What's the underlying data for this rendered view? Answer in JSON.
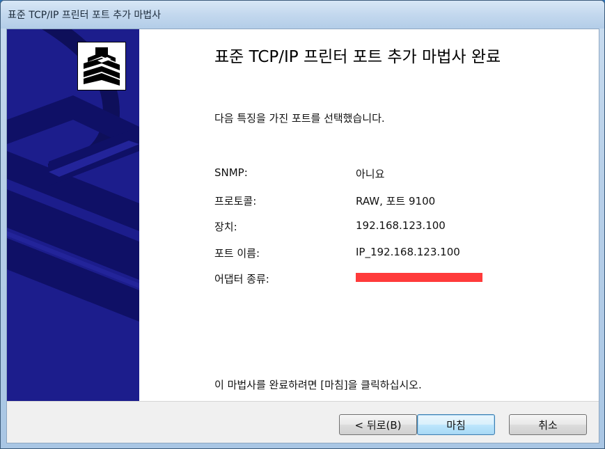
{
  "window": {
    "title": "표준 TCP/IP 프린터 포트 추가 마법사"
  },
  "main": {
    "heading": "표준 TCP/IP 프린터 포트 추가 마법사 완료",
    "intro": "다음 특징을 가진 포트를 선택했습니다.",
    "rows": [
      {
        "label": "SNMP:",
        "value": "아니요"
      },
      {
        "label": "프로토콜:",
        "value": "RAW, 포트 9100"
      },
      {
        "label": "장치:",
        "value": "192.168.123.100"
      },
      {
        "label": "포트 이름:",
        "value": "IP_192.168.123.100"
      },
      {
        "label": "어댑터 종류:",
        "value": ""
      }
    ],
    "footer": "이 마법사를 완료하려면 [마침]을 클릭하십시오."
  },
  "buttons": {
    "back": "< 뒤로(B)",
    "finish": "마침",
    "cancel": "취소"
  },
  "colors": {
    "banner": "#1c1d8c",
    "redaction": "#ff3b3b",
    "default_button_border": "#3c7fb1"
  },
  "icons": {
    "wizard": "printer-wizard-icon",
    "banner": "printer-banner-illustration"
  }
}
